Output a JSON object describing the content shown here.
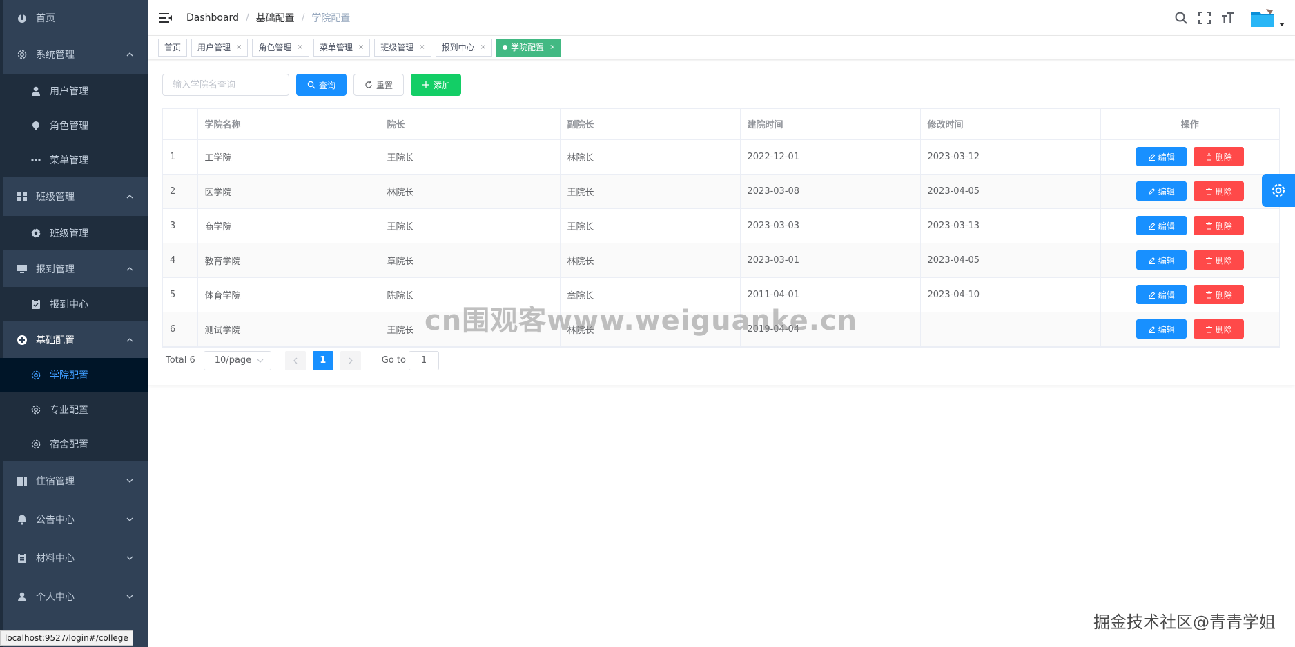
{
  "sidebar": {
    "items": [
      {
        "label": "首页",
        "icon": "dashboard-icon"
      },
      {
        "label": "系统管理",
        "icon": "gear-icon"
      },
      {
        "label": "用户管理",
        "icon": "user-icon"
      },
      {
        "label": "角色管理",
        "icon": "role-icon"
      },
      {
        "label": "菜单管理",
        "icon": "dots-icon"
      },
      {
        "label": "班级管理",
        "icon": "grid-icon"
      },
      {
        "label": "班级管理",
        "icon": "gear-icon"
      },
      {
        "label": "报到管理",
        "icon": "monitor-icon"
      },
      {
        "label": "报到中心",
        "icon": "clipboard-icon"
      },
      {
        "label": "基础配置",
        "icon": "plus-circle-icon"
      },
      {
        "label": "学院配置",
        "icon": "gear-icon"
      },
      {
        "label": "专业配置",
        "icon": "gear-icon"
      },
      {
        "label": "宿舍配置",
        "icon": "gear-icon"
      },
      {
        "label": "住宿管理",
        "icon": "building-icon"
      },
      {
        "label": "公告中心",
        "icon": "bell-icon"
      },
      {
        "label": "材料中心",
        "icon": "clipboard-icon"
      },
      {
        "label": "个人中心",
        "icon": "user-icon"
      }
    ]
  },
  "breadcrumb": [
    "Dashboard",
    "基础配置",
    "学院配置"
  ],
  "tags": [
    {
      "label": "首页"
    },
    {
      "label": "用户管理"
    },
    {
      "label": "角色管理"
    },
    {
      "label": "菜单管理"
    },
    {
      "label": "班级管理"
    },
    {
      "label": "报到中心"
    },
    {
      "label": "学院配置",
      "active": true
    }
  ],
  "toolbar": {
    "search_placeholder": "输入学院名查询",
    "query_label": "查询",
    "reset_label": "重置",
    "add_label": "添加"
  },
  "table": {
    "columns": [
      "",
      "学院名称",
      "院长",
      "副院长",
      "建院时间",
      "修改时间",
      "操作"
    ],
    "rows": [
      {
        "idx": "1",
        "name": "工学院",
        "dean": "王院长",
        "vice": "林院长",
        "created": "2022-12-01",
        "modified": "2023-03-12"
      },
      {
        "idx": "2",
        "name": "医学院",
        "dean": "林院长",
        "vice": "王院长",
        "created": "2023-03-08",
        "modified": "2023-04-05"
      },
      {
        "idx": "3",
        "name": "商学院",
        "dean": "王院长",
        "vice": "王院长",
        "created": "2023-03-03",
        "modified": "2023-03-13"
      },
      {
        "idx": "4",
        "name": "教育学院",
        "dean": "章院长",
        "vice": "林院长",
        "created": "2023-03-01",
        "modified": "2023-04-05"
      },
      {
        "idx": "5",
        "name": "体育学院",
        "dean": "陈院长",
        "vice": "章院长",
        "created": "2011-04-01",
        "modified": "2023-04-10"
      },
      {
        "idx": "6",
        "name": "测试学院",
        "dean": "王院长",
        "vice": "林院长",
        "created": "2019-04-04",
        "modified": ""
      }
    ],
    "edit_label": "编辑",
    "delete_label": "删除"
  },
  "pagination": {
    "total": "Total 6",
    "page_size": "10/page",
    "current": "1",
    "goto_label": "Go to",
    "goto_value": "1"
  },
  "watermark": "cn围观客www.weiguanke.cn",
  "watermark2": "掘金技术社区@青青学姐",
  "status_url": "localhost:9527/login#/college",
  "colors": {
    "sidebar_bg": "#304156",
    "primary": "#1890ff",
    "success": "#13ce66",
    "danger": "#ff4949",
    "active_tag": "#42b983"
  }
}
